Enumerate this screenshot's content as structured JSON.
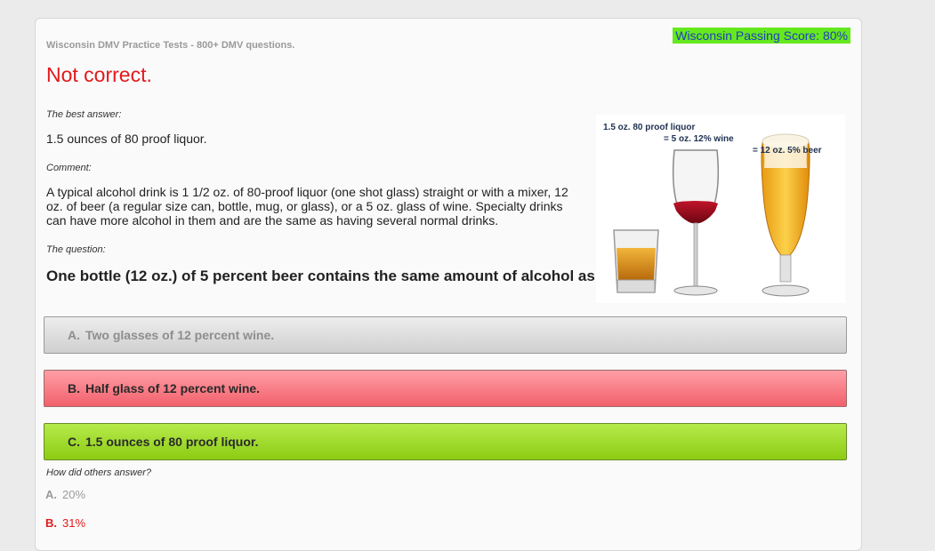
{
  "header": {
    "site_title": "Wisconsin DMV Practice Tests - 800+ DMV questions.",
    "passing_score": "Wisconsin Passing Score: 80%"
  },
  "result": {
    "title": "Not correct.",
    "best_answer_label": "The best answer:",
    "best_answer": "1.5 ounces of 80 proof liquor.",
    "comment_label": "Comment:",
    "comment": "A typical alcohol drink is 1 1/2 oz. of 80-proof liquor (one shot glass) straight or with a mixer, 12 oz. of beer (a regular size can, bottle, mug, or glass), or a 5 oz. glass of wine. Specialty drinks can have more alcohol in them and are the same as having several normal drinks.",
    "question_label": "The question:",
    "question": "One bottle (12 oz.) of 5 percent beer contains the same amount of alcohol as:"
  },
  "illustration": {
    "label_liquor": "1.5 oz. 80 proof liquor",
    "label_wine": "= 5 oz. 12% wine",
    "label_beer": "= 12 oz. 5% beer"
  },
  "answers": [
    {
      "letter": "A.",
      "text": "Two glasses of 12 percent wine."
    },
    {
      "letter": "B.",
      "text": "Half glass of 12 percent wine."
    },
    {
      "letter": "C.",
      "text": "1.5 ounces of 80 proof liquor."
    }
  ],
  "stats": {
    "label": "How did others answer?",
    "items": [
      {
        "letter": "A.",
        "value": "20%"
      },
      {
        "letter": "B.",
        "value": "31%"
      }
    ]
  },
  "colors": {
    "incorrect": "#e2191c",
    "correct": "#8ccc14",
    "selected_wrong": "#f2606c",
    "passing_score_bg": "#66e81e"
  }
}
